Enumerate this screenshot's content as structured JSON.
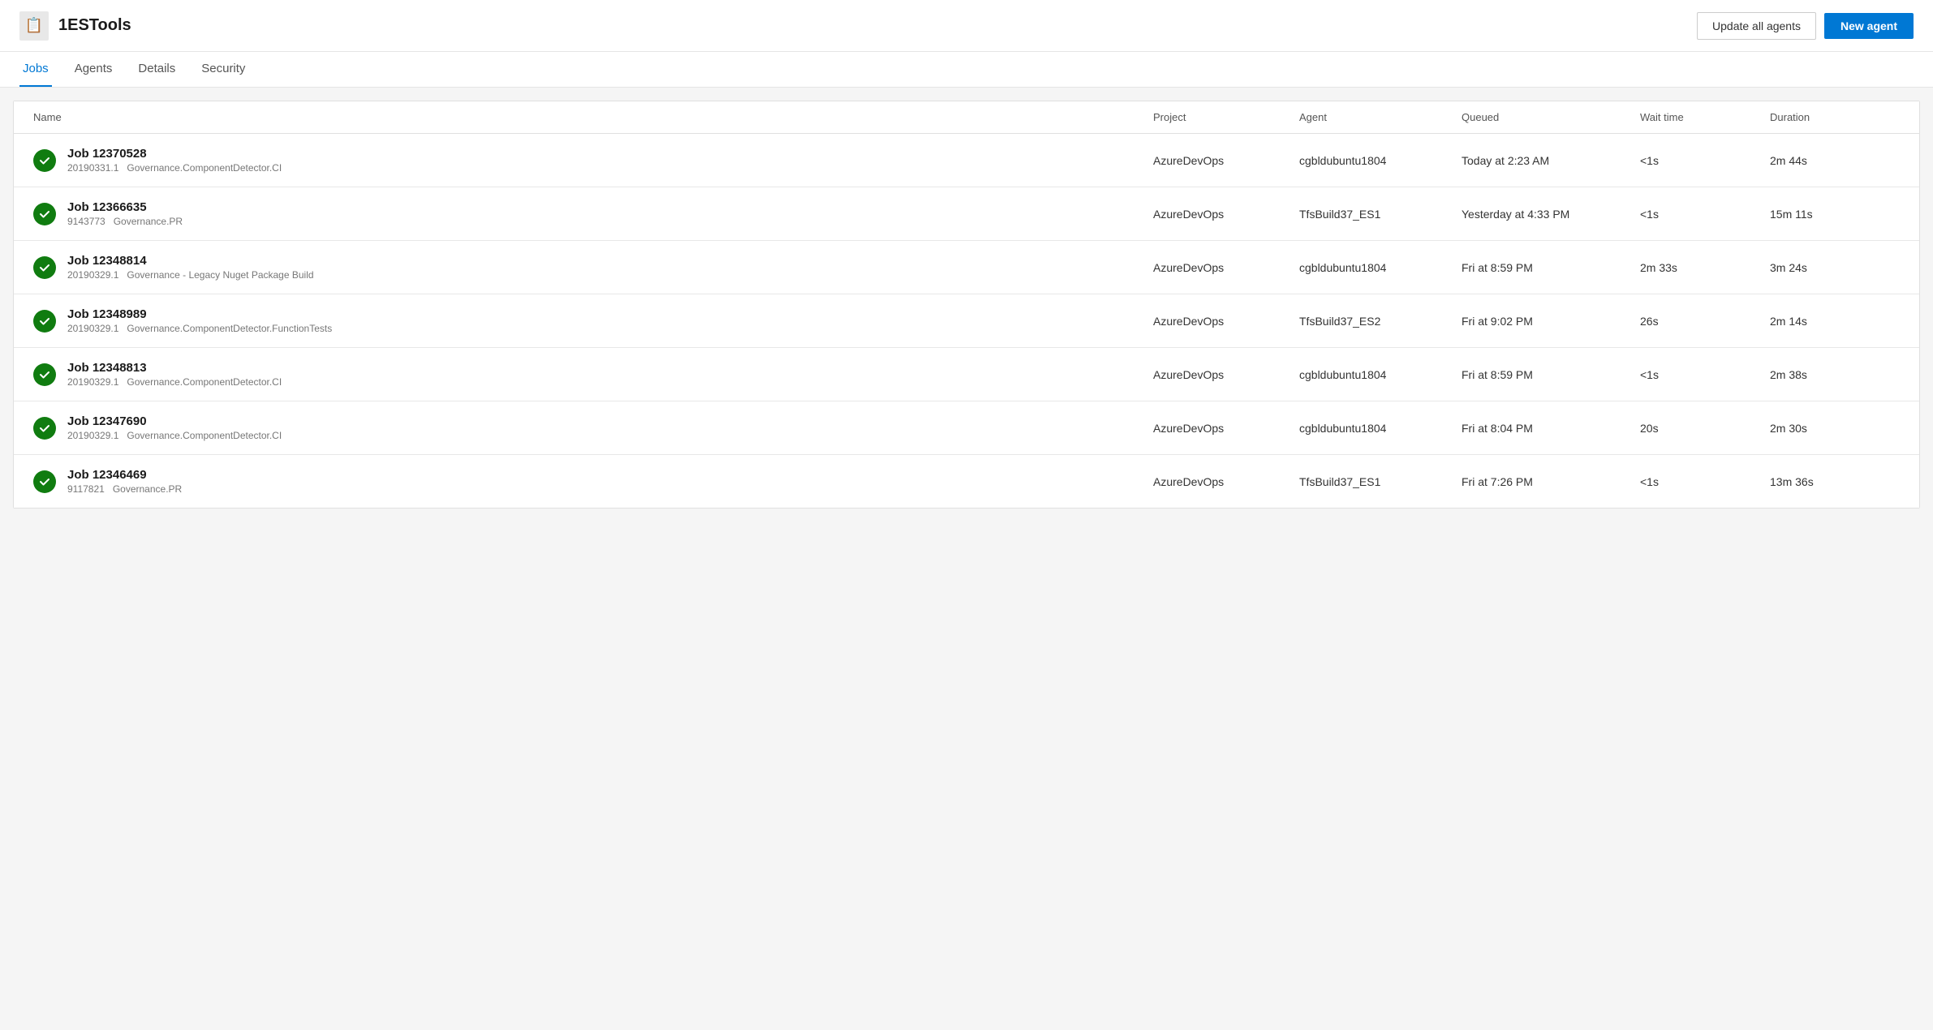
{
  "header": {
    "logo_icon": "📄",
    "title": "1ESTools",
    "update_agents_label": "Update all agents",
    "new_agent_label": "New agent"
  },
  "tabs": [
    {
      "id": "jobs",
      "label": "Jobs",
      "active": true
    },
    {
      "id": "agents",
      "label": "Agents",
      "active": false
    },
    {
      "id": "details",
      "label": "Details",
      "active": false
    },
    {
      "id": "security",
      "label": "Security",
      "active": false
    }
  ],
  "table": {
    "columns": [
      {
        "id": "name",
        "label": "Name"
      },
      {
        "id": "project",
        "label": "Project"
      },
      {
        "id": "agent",
        "label": "Agent"
      },
      {
        "id": "queued",
        "label": "Queued"
      },
      {
        "id": "wait_time",
        "label": "Wait time"
      },
      {
        "id": "duration",
        "label": "Duration"
      }
    ],
    "rows": [
      {
        "id": "job-12370528",
        "status": "success",
        "job_name": "Job 12370528",
        "job_id": "20190331.1",
        "job_pipeline": "Governance.ComponentDetector.CI",
        "project": "AzureDevOps",
        "agent": "cgbldubuntu1804",
        "queued": "Today at 2:23 AM",
        "wait_time": "<1s",
        "duration": "2m 44s"
      },
      {
        "id": "job-12366635",
        "status": "success",
        "job_name": "Job 12366635",
        "job_id": "9143773",
        "job_pipeline": "Governance.PR",
        "project": "AzureDevOps",
        "agent": "TfsBuild37_ES1",
        "queued": "Yesterday at 4:33 PM",
        "wait_time": "<1s",
        "duration": "15m 11s"
      },
      {
        "id": "job-12348814",
        "status": "success",
        "job_name": "Job 12348814",
        "job_id": "20190329.1",
        "job_pipeline": "Governance - Legacy Nuget Package Build",
        "project": "AzureDevOps",
        "agent": "cgbldubuntu1804",
        "queued": "Fri at 8:59 PM",
        "wait_time": "2m 33s",
        "duration": "3m 24s"
      },
      {
        "id": "job-12348989",
        "status": "success",
        "job_name": "Job 12348989",
        "job_id": "20190329.1",
        "job_pipeline": "Governance.ComponentDetector.FunctionTests",
        "project": "AzureDevOps",
        "agent": "TfsBuild37_ES2",
        "queued": "Fri at 9:02 PM",
        "wait_time": "26s",
        "duration": "2m 14s"
      },
      {
        "id": "job-12348813",
        "status": "success",
        "job_name": "Job 12348813",
        "job_id": "20190329.1",
        "job_pipeline": "Governance.ComponentDetector.CI",
        "project": "AzureDevOps",
        "agent": "cgbldubuntu1804",
        "queued": "Fri at 8:59 PM",
        "wait_time": "<1s",
        "duration": "2m 38s"
      },
      {
        "id": "job-12347690",
        "status": "success",
        "job_name": "Job 12347690",
        "job_id": "20190329.1",
        "job_pipeline": "Governance.ComponentDetector.CI",
        "project": "AzureDevOps",
        "agent": "cgbldubuntu1804",
        "queued": "Fri at 8:04 PM",
        "wait_time": "20s",
        "duration": "2m 30s"
      },
      {
        "id": "job-12346469",
        "status": "success",
        "job_name": "Job 12346469",
        "job_id": "9117821",
        "job_pipeline": "Governance.PR",
        "project": "AzureDevOps",
        "agent": "TfsBuild37_ES1",
        "queued": "Fri at 7:26 PM",
        "wait_time": "<1s",
        "duration": "13m 36s"
      }
    ]
  }
}
